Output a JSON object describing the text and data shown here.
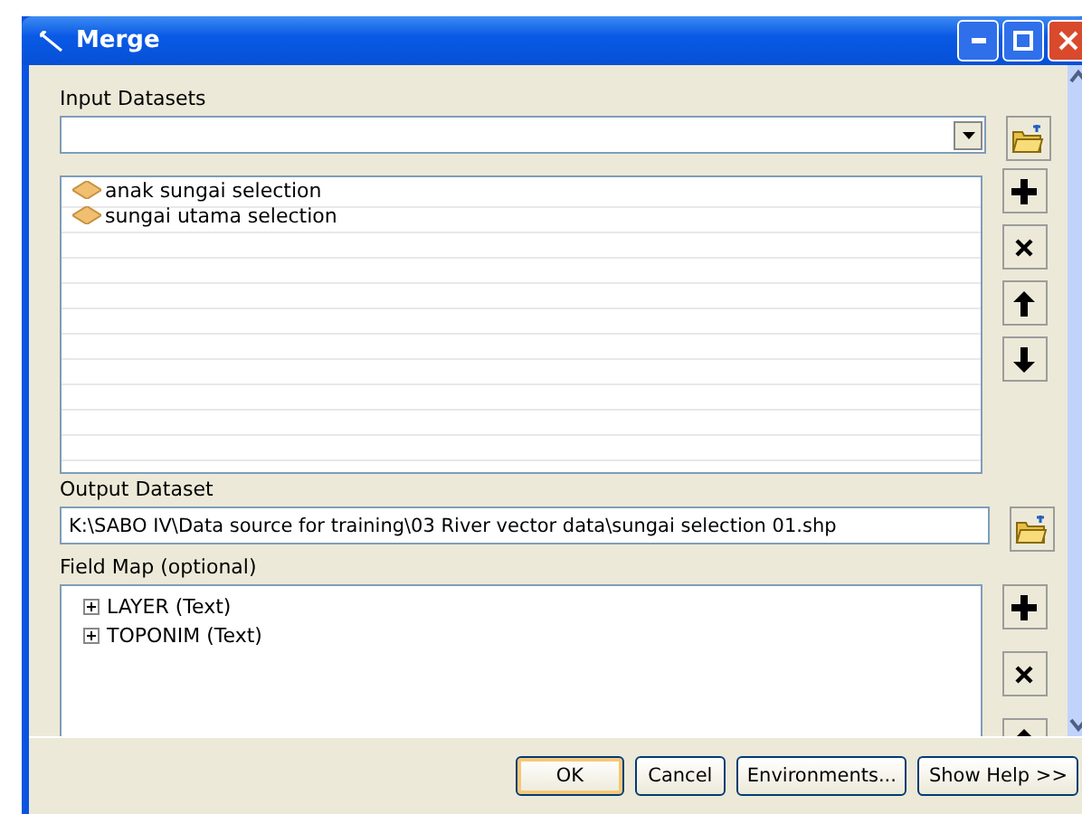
{
  "window": {
    "title": "Merge"
  },
  "input_datasets": {
    "label": "Input Datasets",
    "items": [
      {
        "name": "anak sungai selection"
      },
      {
        "name": "sungai utama selection"
      }
    ]
  },
  "output_dataset": {
    "label": "Output Dataset",
    "value": "K:\\SABO IV\\Data source for training\\03 River vector data\\sungai selection 01.shp"
  },
  "field_map": {
    "label": "Field Map (optional)",
    "items": [
      {
        "name": "LAYER (Text)",
        "expanded": false
      },
      {
        "name": "TOPONIM (Text)",
        "expanded": false
      }
    ]
  },
  "buttons": [
    "OK",
    "Cancel",
    "Environments...",
    "Show Help >>"
  ]
}
